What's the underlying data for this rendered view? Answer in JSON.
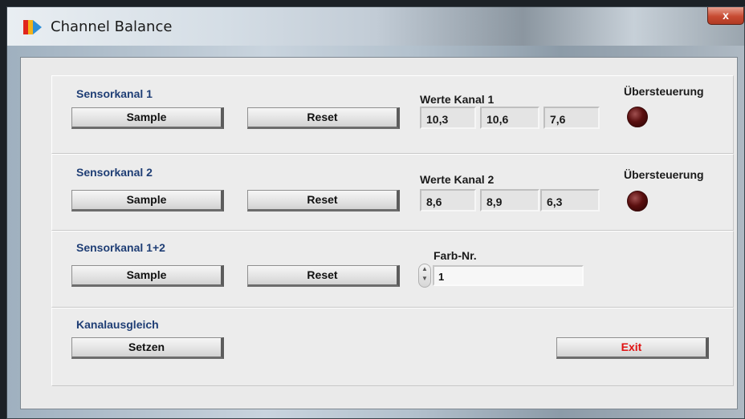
{
  "window": {
    "title": "Channel Balance",
    "close_label": "x"
  },
  "section1": {
    "label": "Sensorkanal 1",
    "sample_label": "Sample",
    "reset_label": "Reset",
    "values_label": "Werte Kanal 1",
    "values": [
      "10,3",
      "10,6",
      "7,6"
    ],
    "overflow_label": "Übersteuerung"
  },
  "section2": {
    "label": "Sensorkanal 2",
    "sample_label": "Sample",
    "reset_label": "Reset",
    "values_label": "Werte Kanal 2",
    "values": [
      "8,6",
      "8,9",
      "6,3"
    ],
    "overflow_label": "Übersteuerung"
  },
  "section3": {
    "label": "Sensorkanal 1+2",
    "sample_label": "Sample",
    "reset_label": "Reset",
    "color_label": "Farb-Nr.",
    "color_value": "1"
  },
  "section4": {
    "label": "Kanalausgleich",
    "set_label": "Setzen",
    "exit_label": "Exit"
  },
  "colors": {
    "section_label": "#1f3e75",
    "exit_text": "#e01010",
    "led_off": "#5a0f0f"
  }
}
